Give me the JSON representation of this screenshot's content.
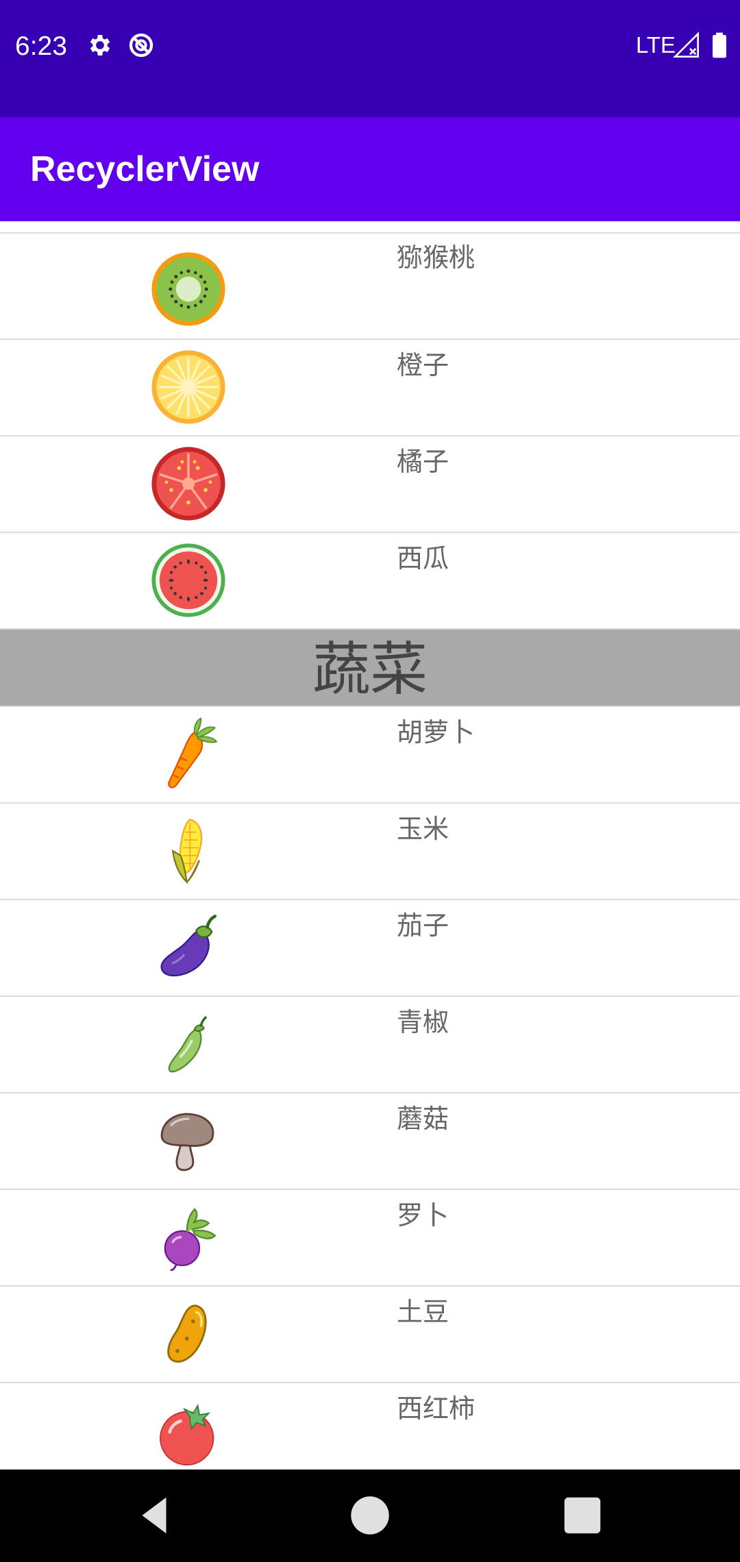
{
  "status_bar": {
    "time": "6:23",
    "network": "LTE",
    "icons": [
      "settings-icon",
      "no-disturb-icon",
      "signal-icon",
      "battery-icon"
    ]
  },
  "app_bar": {
    "title": "RecyclerView"
  },
  "list": {
    "fruits": [
      {
        "label": "猕猴桃",
        "icon": "kiwi-icon"
      },
      {
        "label": "橙子",
        "icon": "orange-icon"
      },
      {
        "label": "橘子",
        "icon": "tangerine-icon"
      },
      {
        "label": "西瓜",
        "icon": "watermelon-icon"
      }
    ],
    "section_header": "蔬菜",
    "vegetables": [
      {
        "label": "胡萝卜",
        "icon": "carrot-icon"
      },
      {
        "label": "玉米",
        "icon": "corn-icon"
      },
      {
        "label": "茄子",
        "icon": "eggplant-icon"
      },
      {
        "label": "青椒",
        "icon": "green-pepper-icon"
      },
      {
        "label": "蘑菇",
        "icon": "mushroom-icon"
      },
      {
        "label": "罗卜",
        "icon": "radish-icon"
      },
      {
        "label": "土豆",
        "icon": "potato-icon"
      },
      {
        "label": "西红柿",
        "icon": "tomato-icon"
      }
    ]
  },
  "colors": {
    "status_bar": "#3700b3",
    "app_bar": "#6200ee",
    "section_header_bg": "#a9a9a9",
    "nav_bar": "#000000"
  },
  "nav_bar": {
    "buttons": [
      "back-icon",
      "home-icon",
      "recents-icon"
    ]
  }
}
